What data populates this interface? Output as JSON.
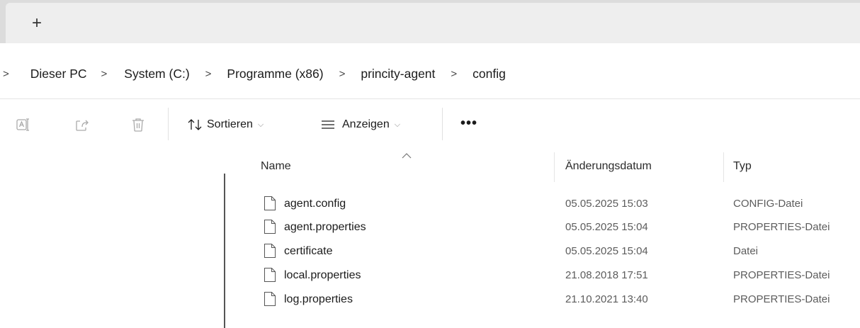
{
  "tabbar": {
    "new_tab_label": "+"
  },
  "breadcrumb": {
    "separator": ">",
    "items": [
      "Dieser PC",
      "System (C:)",
      "Programme (x86)",
      "princity-agent",
      "config"
    ]
  },
  "toolbar": {
    "icons": [
      "rename-icon",
      "share-icon",
      "delete-icon"
    ],
    "sort_label": "Sortieren",
    "view_label": "Anzeigen",
    "more_label": "•••"
  },
  "columns": {
    "name": "Name",
    "date": "Änderungsdatum",
    "type": "Typ"
  },
  "files": [
    {
      "name": "agent.config",
      "date": "05.05.2025 15:03",
      "type": "CONFIG-Datei"
    },
    {
      "name": "agent.properties",
      "date": "05.05.2025 15:04",
      "type": "PROPERTIES-Datei"
    },
    {
      "name": "certificate",
      "date": "05.05.2025 15:04",
      "type": "Datei"
    },
    {
      "name": "local.properties",
      "date": "21.08.2018 17:51",
      "type": "PROPERTIES-Datei"
    },
    {
      "name": "log.properties",
      "date": "21.10.2021 13:40",
      "type": "PROPERTIES-Datei"
    }
  ]
}
